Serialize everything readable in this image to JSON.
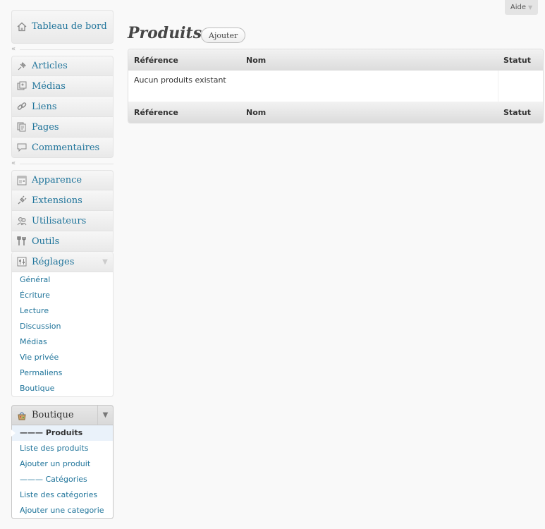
{
  "help": {
    "label": "Aide"
  },
  "menu": {
    "dashboard": "Tableau de bord",
    "group1": [
      "Articles",
      "Médias",
      "Liens",
      "Pages",
      "Commentaires"
    ],
    "group2": [
      "Apparence",
      "Extensions",
      "Utilisateurs",
      "Outils",
      "Réglages"
    ],
    "reglages_sub": [
      "Général",
      "Écriture",
      "Lecture",
      "Discussion",
      "Médias",
      "Vie privée",
      "Permaliens",
      "Boutique"
    ],
    "boutique": "Boutique",
    "boutique_sub": [
      "——— Produits",
      "Liste des produits",
      "Ajouter un produit",
      "——— Catégories",
      "Liste des catégories",
      "Ajouter une categorie"
    ]
  },
  "page": {
    "title": "Produits",
    "add_button": "Ajouter"
  },
  "table": {
    "columns": [
      "Référence",
      "Nom",
      "Statut"
    ],
    "empty_message": "Aucun produits existant"
  },
  "colors": {
    "link": "#21759b",
    "background": "#f9f9f9"
  },
  "icons": {
    "dashboard": "home-icon",
    "articles": "pin-icon",
    "medias": "media-icon",
    "liens": "link-icon",
    "pages": "pages-icon",
    "commentaires": "comment-icon",
    "apparence": "appearance-icon",
    "extensions": "plugin-icon",
    "utilisateurs": "users-icon",
    "outils": "tools-icon",
    "reglages": "settings-icon",
    "boutique": "shop-icon"
  }
}
